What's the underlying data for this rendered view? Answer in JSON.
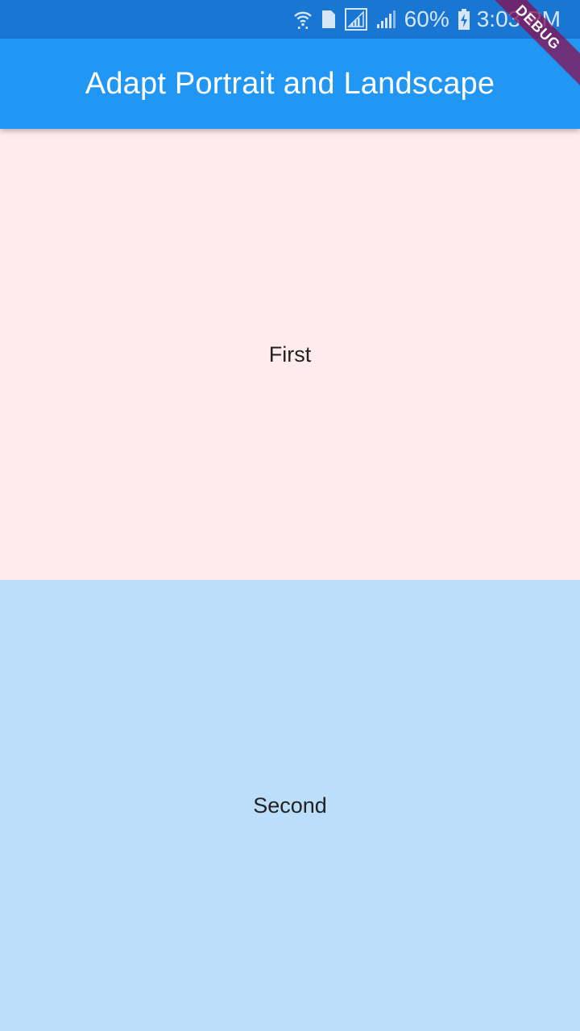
{
  "status_bar": {
    "icons": [
      "wifi-icon",
      "sim-1-icon",
      "signal-1-icon",
      "signal-2-icon",
      "battery-charging-icon"
    ],
    "sim_number": "1",
    "battery_percent": "60%",
    "time": "3:03 PM"
  },
  "app_bar": {
    "title": "Adapt Portrait and Landscape"
  },
  "panels": [
    {
      "label": "First",
      "color": "#ffebee"
    },
    {
      "label": "Second",
      "color": "#bbdefb"
    }
  ],
  "debug_banner": {
    "label": "DEBUG"
  },
  "colors": {
    "status_bar": "#1976d2",
    "app_bar": "#2196f3"
  }
}
